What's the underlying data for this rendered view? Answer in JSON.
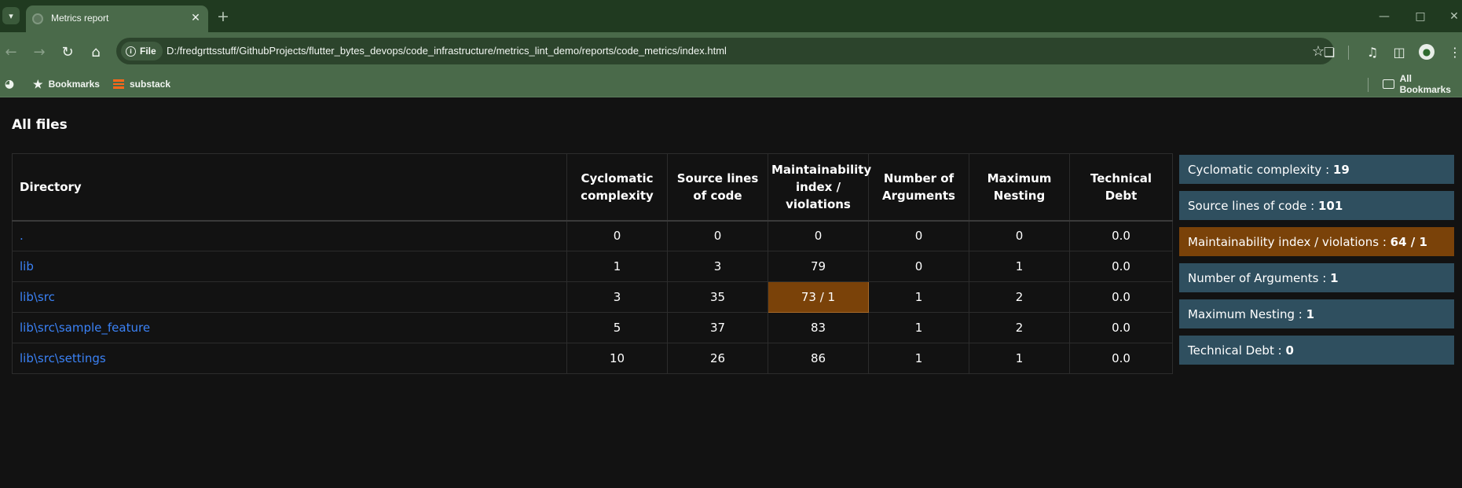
{
  "browser": {
    "tab_title": "Metrics report",
    "site_chip": "File",
    "url": "D:/fredgrttsstuff/GithubProjects/flutter_bytes_devops/code_infrastructure/metrics_lint_demo/reports/code_metrics/index.html",
    "bookmarks": [
      {
        "label": "Bookmarks",
        "icon": "star-icon"
      },
      {
        "label": "substack",
        "icon": "substack-favicon"
      }
    ],
    "all_bookmarks": "All Bookmarks",
    "accent_color": "#4a6a4a"
  },
  "page": {
    "heading": "All files",
    "table": {
      "headers": [
        "Directory",
        "Cyclomatic complexity",
        "Source lines of code",
        "Maintainability index / violations",
        "Number of Arguments",
        "Maximum Nesting",
        "Technical Debt"
      ],
      "rows": [
        {
          "dir": ".",
          "cyclomatic": "0",
          "sloc": "0",
          "maintainability": "0",
          "args": "0",
          "nesting": "0",
          "debt": "0.0"
        },
        {
          "dir": "lib",
          "cyclomatic": "1",
          "sloc": "3",
          "maintainability": "79",
          "args": "0",
          "nesting": "1",
          "debt": "0.0"
        },
        {
          "dir": "lib\\src",
          "cyclomatic": "3",
          "sloc": "35",
          "maintainability": "73 / 1",
          "args": "1",
          "nesting": "2",
          "debt": "0.0"
        },
        {
          "dir": "lib\\src\\sample_feature",
          "cyclomatic": "5",
          "sloc": "37",
          "maintainability": "83",
          "args": "1",
          "nesting": "2",
          "debt": "0.0"
        },
        {
          "dir": "lib\\src\\settings",
          "cyclomatic": "10",
          "sloc": "26",
          "maintainability": "86",
          "args": "1",
          "nesting": "1",
          "debt": "0.0"
        }
      ]
    },
    "summary": [
      {
        "label": "Cyclomatic complexity : ",
        "value": "19"
      },
      {
        "label": "Source lines of code : ",
        "value": "101"
      },
      {
        "label": "Maintainability index / violations : ",
        "value": "64 / 1"
      },
      {
        "label": "Number of Arguments : ",
        "value": "1"
      },
      {
        "label": "Maximum Nesting : ",
        "value": "1"
      },
      {
        "label": "Technical Debt : ",
        "value": "0"
      }
    ],
    "colors": {
      "link": "#3b82f6",
      "violation": "#7a4209",
      "summary_box": "#2f4f5f"
    }
  }
}
